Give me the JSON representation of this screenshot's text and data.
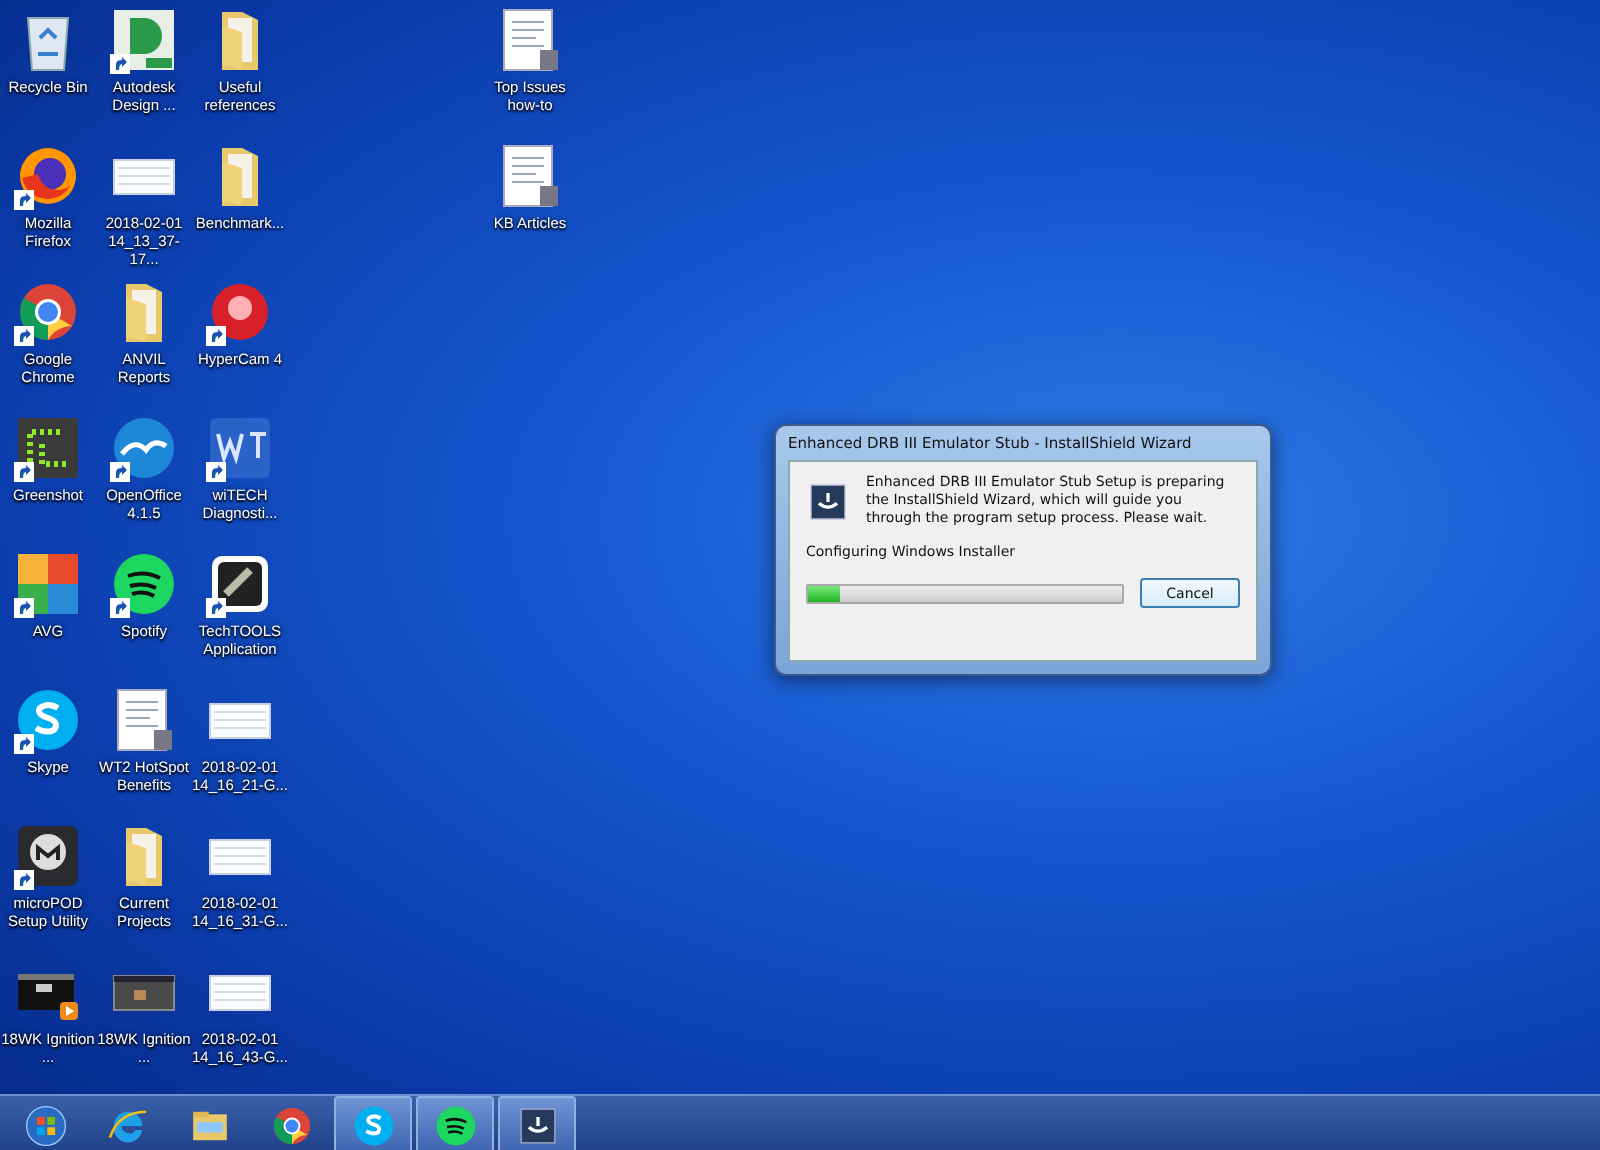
{
  "desktop_icons": [
    {
      "label": "Recycle Bin",
      "kind": "recycle",
      "shortcut": false
    },
    {
      "label": "Autodesk Design ...",
      "kind": "autodesk",
      "shortcut": true
    },
    {
      "label": "Useful references",
      "kind": "folder",
      "shortcut": false
    },
    {
      "label": "Mozilla Firefox",
      "kind": "firefox",
      "shortcut": true
    },
    {
      "label": "2018-02-01 14_13_37-17...",
      "kind": "screenshot",
      "shortcut": false
    },
    {
      "label": "Benchmark...",
      "kind": "folder",
      "shortcut": false
    },
    {
      "label": "Google Chrome",
      "kind": "chrome",
      "shortcut": true
    },
    {
      "label": "ANVIL Reports",
      "kind": "folder",
      "shortcut": false
    },
    {
      "label": "HyperCam 4",
      "kind": "hypercam",
      "shortcut": true
    },
    {
      "label": "Greenshot",
      "kind": "greenshot",
      "shortcut": true
    },
    {
      "label": "OpenOffice 4.1.5",
      "kind": "openoffice",
      "shortcut": true
    },
    {
      "label": "wiTECH Diagnosti...",
      "kind": "witech",
      "shortcut": true
    },
    {
      "label": "AVG",
      "kind": "avg",
      "shortcut": true
    },
    {
      "label": "Spotify",
      "kind": "spotify",
      "shortcut": true
    },
    {
      "label": "TechTOOLS Application",
      "kind": "techtools",
      "shortcut": true
    },
    {
      "label": "Skype",
      "kind": "skype",
      "shortcut": true
    },
    {
      "label": "WT2 HotSpot Benefits",
      "kind": "document",
      "shortcut": false
    },
    {
      "label": "2018-02-01 14_16_21-G...",
      "kind": "screenshot",
      "shortcut": false
    },
    {
      "label": "microPOD Setup Utility",
      "kind": "micropod",
      "shortcut": true
    },
    {
      "label": "Current Projects",
      "kind": "folder",
      "shortcut": false
    },
    {
      "label": "2018-02-01 14_16_31-G...",
      "kind": "screenshot",
      "shortcut": false
    },
    {
      "label": "18WK Ignition ...",
      "kind": "video",
      "shortcut": false
    },
    {
      "label": "18WK Ignition ...",
      "kind": "dark-screenshot",
      "shortcut": false
    },
    {
      "label": "2018-02-01 14_16_43-G...",
      "kind": "screenshot",
      "shortcut": false
    }
  ],
  "far_icons": [
    {
      "label": "Top Issues how-to",
      "kind": "document",
      "shortcut": false
    },
    {
      "label": "KB Articles",
      "kind": "document",
      "shortcut": false
    }
  ],
  "dialog": {
    "title": "Enhanced DRB III Emulator Stub - InstallShield Wizard",
    "message": "Enhanced DRB III Emulator Stub Setup is preparing the InstallShield Wizard, which will guide you through the program setup process.  Please wait.",
    "status": "Configuring Windows Installer",
    "progress": {
      "level": 0.1
    },
    "button": "Cancel"
  },
  "taskbar": [
    {
      "kind": "start",
      "running": false
    },
    {
      "kind": "ie",
      "running": false
    },
    {
      "kind": "explorer",
      "running": false
    },
    {
      "kind": "chrome",
      "running": false
    },
    {
      "kind": "skype",
      "running": true
    },
    {
      "kind": "spotify",
      "running": true
    },
    {
      "kind": "installer",
      "running": true
    }
  ]
}
